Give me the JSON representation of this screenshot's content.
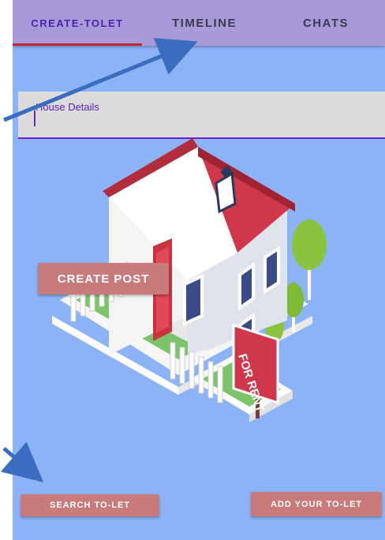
{
  "tabs": [
    {
      "label": "CREATE-TOLET",
      "selected": true
    },
    {
      "label": "TIMELINE",
      "selected": false
    },
    {
      "label": "CHATS",
      "selected": false
    }
  ],
  "house_details": {
    "label": "House Details",
    "value": ""
  },
  "illustration": {
    "sign_text": "FOR RENT"
  },
  "buttons": {
    "create_post": "CREATE POST",
    "search": "SEARCH TO-LET",
    "add": "ADD YOUR TO-LET"
  },
  "colors": {
    "tab_bar": "#a89ad8",
    "indicator": "#c0262e",
    "background": "#8db3f7",
    "button": "#c97b7b",
    "arrow": "#3a6cc0"
  },
  "icons": [
    "house-illustration",
    "annotation-arrow"
  ]
}
